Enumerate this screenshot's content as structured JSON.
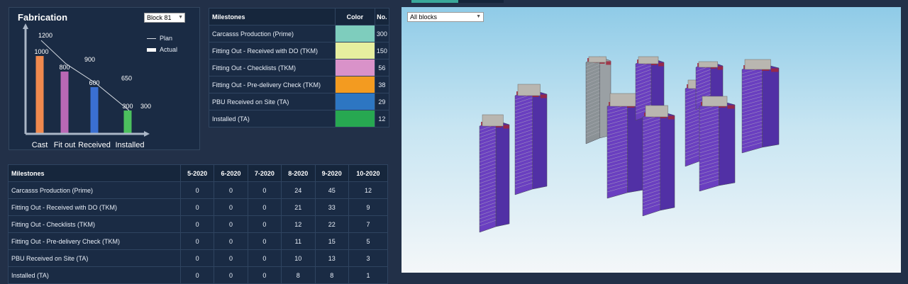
{
  "fabrication": {
    "title": "Fabrication",
    "block_select": "Block 81",
    "legend": {
      "plan": "Plan",
      "actual": "Actual"
    },
    "chart_data": {
      "type": "bar",
      "categories": [
        "Cast",
        "Fit out",
        "Received",
        "Installed"
      ],
      "series": [
        {
          "name": "Plan",
          "values": [
            1200,
            900,
            650,
            300
          ]
        },
        {
          "name": "Actual",
          "values": [
            1000,
            800,
            600,
            300
          ]
        }
      ],
      "bar_colors": [
        "#f0894e",
        "#b968b5",
        "#3a6fd1",
        "#4cc05e"
      ],
      "ylim": [
        0,
        1400
      ]
    }
  },
  "milestones_table": {
    "headers": [
      "Milestones",
      "Color",
      "No."
    ],
    "rows": [
      {
        "name": "Carcasss Production (Prime)",
        "color": "#7ecdbd",
        "no": "300"
      },
      {
        "name": "Fitting Out - Received with DO (TKM)",
        "color": "#e7ef9f",
        "no": "150"
      },
      {
        "name": "Fitting Out - Checklists (TKM)",
        "color": "#d992c9",
        "no": "56"
      },
      {
        "name": "Fitting Out - Pre-delivery Check (TKM)",
        "color": "#f39b20",
        "no": "38"
      },
      {
        "name": "PBU Received on Site (TA)",
        "color": "#2d76c2",
        "no": "29"
      },
      {
        "name": "Installed (TA)",
        "color": "#27a851",
        "no": "12"
      }
    ]
  },
  "monthly_table": {
    "headers": [
      "Milestones",
      "5-2020",
      "6-2020",
      "7-2020",
      "8-2020",
      "9-2020",
      "10-2020"
    ],
    "rows": [
      [
        "Carcasss Production (Prime)",
        "0",
        "0",
        "0",
        "24",
        "45",
        "12"
      ],
      [
        "Fitting Out - Received with DO (TKM)",
        "0",
        "0",
        "0",
        "21",
        "33",
        "9"
      ],
      [
        "Fitting Out - Checklists (TKM)",
        "0",
        "0",
        "0",
        "12",
        "22",
        "7"
      ],
      [
        "Fitting Out - Pre-delivery Check (TKM)",
        "0",
        "0",
        "0",
        "11",
        "15",
        "5"
      ],
      [
        "PBU Received on Site (TA)",
        "0",
        "0",
        "0",
        "10",
        "13",
        "3"
      ],
      [
        "Installed (TA)",
        "0",
        "0",
        "0",
        "8",
        "8",
        "1"
      ]
    ]
  },
  "viewer": {
    "filter_select": "All blocks"
  }
}
